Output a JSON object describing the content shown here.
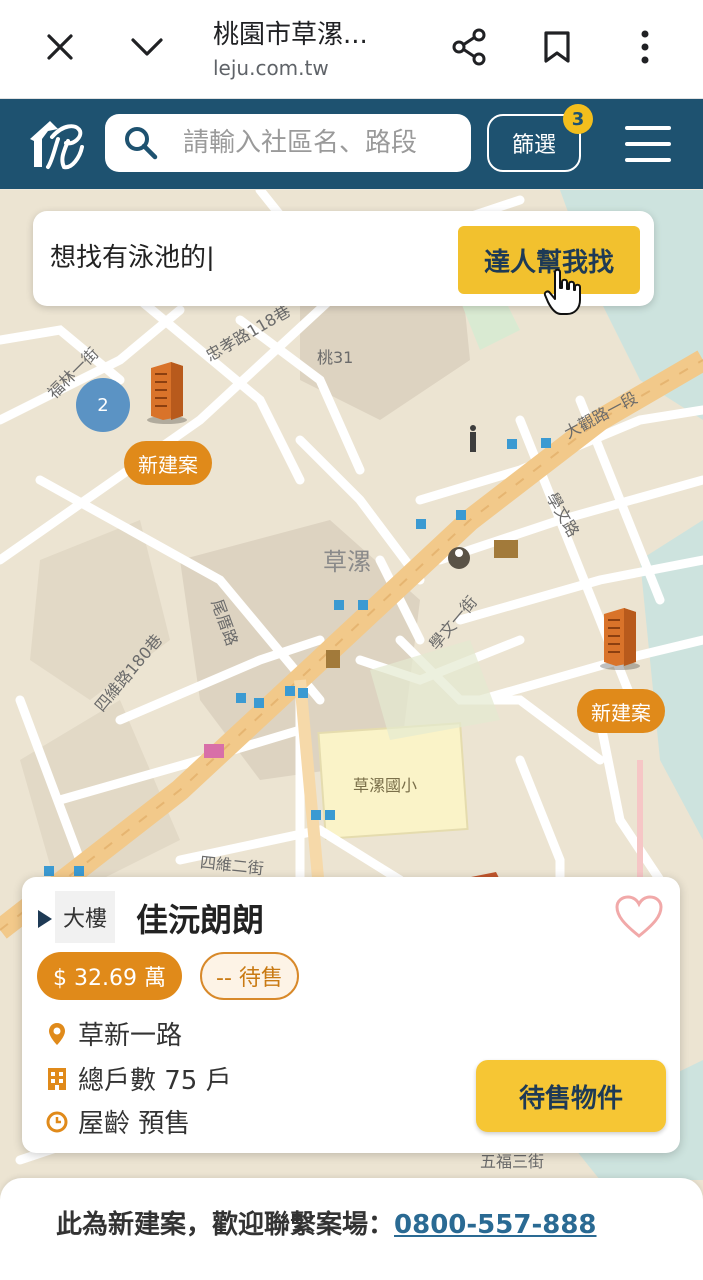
{
  "browser": {
    "title": "桃園市草漯...",
    "url": "leju.com.tw"
  },
  "header": {
    "search_placeholder": "請輸入社區名、路段",
    "filter_label": "篩選",
    "filter_count": "3"
  },
  "expert": {
    "input_value": "想找有泳池的|",
    "button_label": "達人幫我找"
  },
  "map": {
    "cluster_count": "2",
    "new_project_label": "新建案",
    "labels": {
      "area": "草漯",
      "school": "草漯國小",
      "route": "桃31",
      "road_dayuan": "大觀路一段",
      "road_zhongxiao": "忠孝路118巷",
      "road_fulin": "福林一街",
      "road_wuyun": "五福三街",
      "road_siwei": "四維路180巷",
      "road_siwei2": "四維二街",
      "road_xuewen": "學文一街",
      "road_xuewen2": "學文路",
      "road_weiyi": "尾厝路"
    }
  },
  "card": {
    "type": "大樓",
    "title": "佳沅朗朗",
    "price": "$ 32.69 萬",
    "status": "-- 待售",
    "address": "草新一路",
    "units": "總戶數 75 戶",
    "age": "屋齡 預售",
    "listing_button": "待售物件"
  },
  "bottom": {
    "text": "此為新建案，歡迎聯繫案場：",
    "phone": "0800-557-888"
  },
  "colors": {
    "header_bg": "#1e5270",
    "accent_yellow": "#f2c12e",
    "accent_orange": "#e08a1a"
  }
}
